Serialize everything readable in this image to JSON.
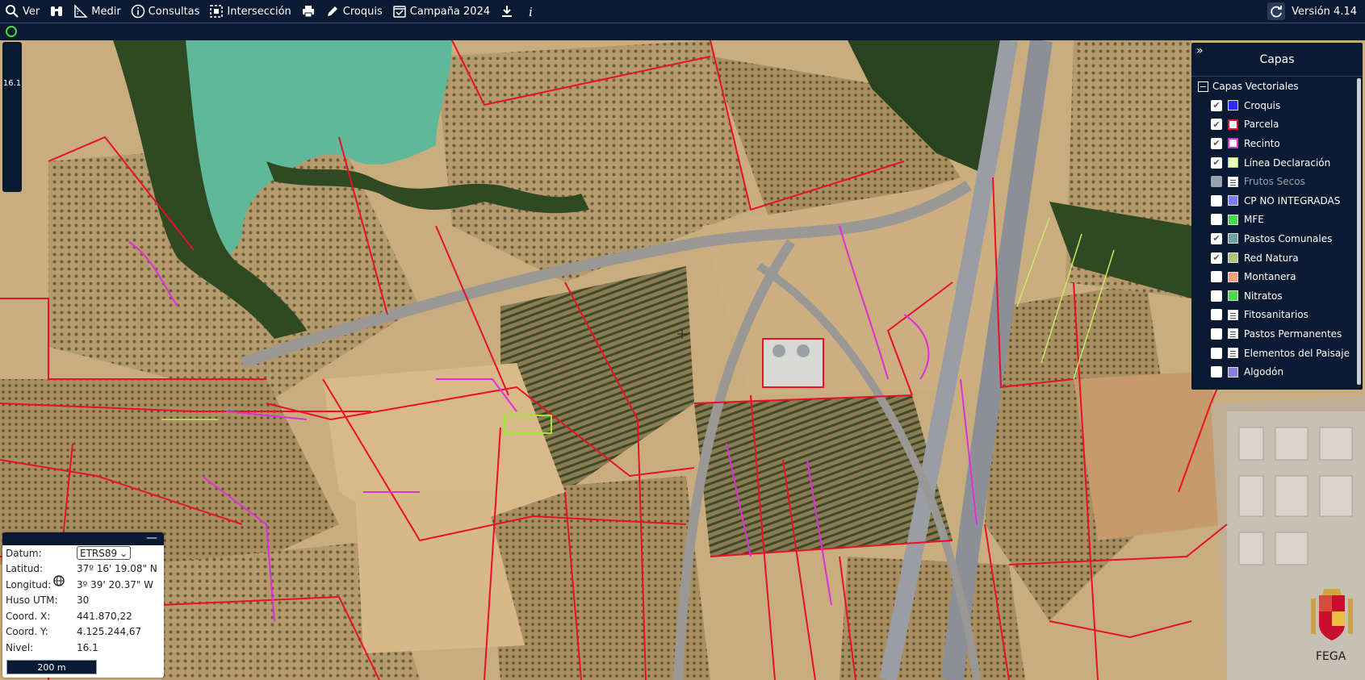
{
  "toolbar": {
    "items": [
      {
        "label": "Ver",
        "icon": "search-icon"
      },
      {
        "label": "",
        "icon": "binoculars-icon"
      },
      {
        "label": "Medir",
        "icon": "ruler-icon"
      },
      {
        "label": "Consultas",
        "icon": "info-circle-icon"
      },
      {
        "label": "Intersección",
        "icon": "dashed-selection-icon"
      },
      {
        "label": "",
        "icon": "printer-icon"
      },
      {
        "label": "Croquis",
        "icon": "pencil-icon"
      },
      {
        "label": "Campaña 2024",
        "icon": "calendar-check-icon"
      },
      {
        "label": "",
        "icon": "download-icon"
      },
      {
        "label": "",
        "icon": "info-italic-icon"
      }
    ],
    "version": "Versión 4.14"
  },
  "zoom_level": "16.1",
  "layers": {
    "title": "Capas",
    "group": "Capas Vectoriales",
    "items": [
      {
        "label": "Croquis",
        "checked": true,
        "color": "#2b2bff",
        "kind": "color",
        "disabled": false
      },
      {
        "label": "Parcela",
        "checked": true,
        "color": "#ffffff",
        "border": "#e8102a",
        "kind": "color",
        "disabled": false
      },
      {
        "label": "Recinto",
        "checked": true,
        "color": "#ffffff",
        "border": "#e02fd8",
        "kind": "color",
        "disabled": false
      },
      {
        "label": "Línea Declaración",
        "checked": true,
        "color": "#f2ffb8",
        "border": "#9ee63c",
        "kind": "color",
        "disabled": false
      },
      {
        "label": "Frutos Secos",
        "checked": false,
        "color": "#ffffff",
        "kind": "list",
        "disabled": true
      },
      {
        "label": "CP NO INTEGRADAS",
        "checked": false,
        "color": "#7c7cff",
        "kind": "color",
        "disabled": false
      },
      {
        "label": "MFE",
        "checked": false,
        "color": "#4ad94a",
        "kind": "color",
        "disabled": false
      },
      {
        "label": "Pastos Comunales",
        "checked": true,
        "color": "#6fa3a3",
        "kind": "color",
        "disabled": false
      },
      {
        "label": "Red Natura",
        "checked": true,
        "color": "#b5c27a",
        "kind": "color",
        "disabled": false
      },
      {
        "label": "Montanera",
        "checked": false,
        "color": "#f2a27a",
        "kind": "color",
        "disabled": false
      },
      {
        "label": "Nitratos",
        "checked": false,
        "color": "#4ad94a",
        "kind": "color",
        "disabled": false
      },
      {
        "label": "Fitosanitarios",
        "checked": false,
        "color": "#ffffff",
        "kind": "list",
        "disabled": false
      },
      {
        "label": "Pastos Permanentes",
        "checked": false,
        "color": "#ffffff",
        "kind": "list",
        "disabled": false
      },
      {
        "label": "Elementos del Paisaje",
        "checked": false,
        "color": "#ffffff",
        "kind": "list",
        "disabled": false
      },
      {
        "label": "Algodón",
        "checked": false,
        "color": "#8a7fd6",
        "kind": "color",
        "disabled": false
      }
    ]
  },
  "coords": {
    "datum_label": "Datum:",
    "datum_value": "ETRS89",
    "lat_label": "Latitud:",
    "lat_value": "37º 16' 19.08\" N",
    "lon_label": "Longitud:",
    "lon_value": "3º 39' 20.37\" W",
    "huso_label": "Huso UTM:",
    "huso_value": "30",
    "x_label": "Coord. X:",
    "x_value": "441.870,22",
    "y_label": "Coord. Y:",
    "y_value": "4.125.244,67",
    "nivel_label": "Nivel:",
    "nivel_value": "16.1",
    "scale": "200 m"
  },
  "footer": {
    "logo_text": "FEGA"
  },
  "colors": {
    "bar": "#0b1a33",
    "parcela": "#e8102a",
    "recinto": "#e02fd8",
    "water": "#5fb89a"
  }
}
